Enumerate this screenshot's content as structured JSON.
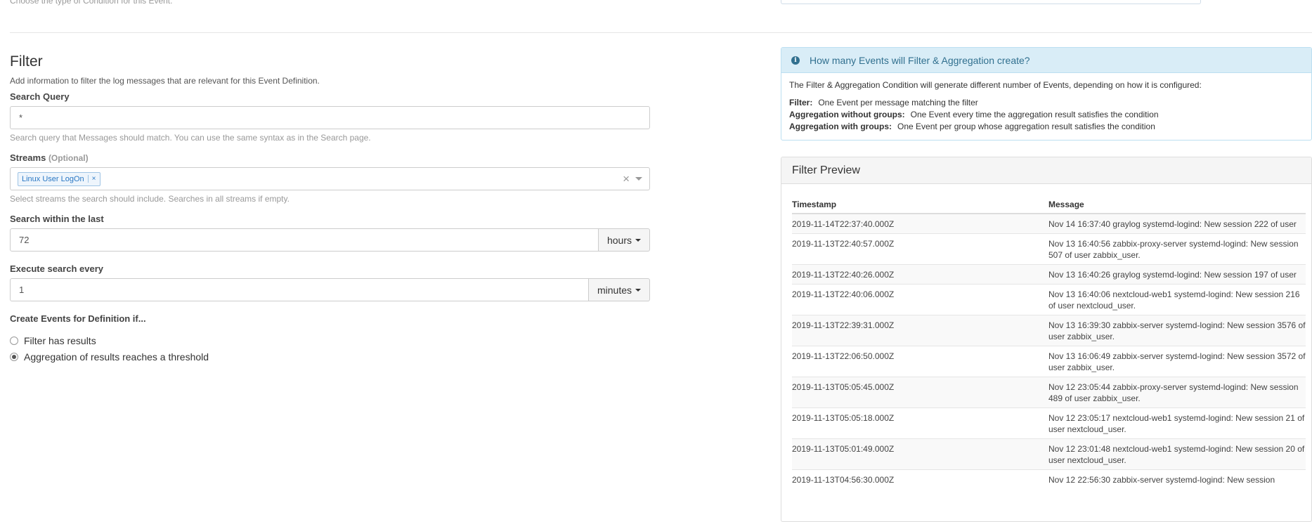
{
  "top": {
    "help_text": "Choose the type of Condition for this Event."
  },
  "filter": {
    "title": "Filter",
    "description": "Add information to filter the log messages that are relevant for this Event Definition.",
    "search_query": {
      "label": "Search Query",
      "value": "*",
      "help": "Search query that Messages should match. You can use the same syntax as in the Search page."
    },
    "streams": {
      "label": "Streams",
      "optional": "(Optional)",
      "selected": [
        "Linux User LogOn"
      ],
      "remove_glyph": "×",
      "help": "Select streams the search should include. Searches in all streams if empty."
    },
    "search_within": {
      "label": "Search within the last",
      "value": "72",
      "unit": "hours"
    },
    "execute_every": {
      "label": "Execute search every",
      "value": "1",
      "unit": "minutes"
    },
    "create_events": {
      "label": "Create Events for Definition if...",
      "options": [
        {
          "label": "Filter has results",
          "checked": false
        },
        {
          "label": "Aggregation of results reaches a threshold",
          "checked": true
        }
      ]
    }
  },
  "info": {
    "icon": "info-circle-icon",
    "title": "How many Events will Filter & Aggregation create?",
    "intro": "The Filter & Aggregation Condition will generate different number of Events, depending on how it is configured:",
    "lines": [
      {
        "term": "Filter:",
        "text": "One Event per message matching the filter"
      },
      {
        "term": "Aggregation without groups:",
        "text": "One Event every time the aggregation result satisfies the condition"
      },
      {
        "term": "Aggregation with groups:",
        "text": "One Event per group whose aggregation result satisfies the condition"
      }
    ]
  },
  "preview": {
    "title": "Filter Preview",
    "columns": [
      "Timestamp",
      "Message"
    ],
    "rows": [
      {
        "timestamp": "2019-11-14T22:37:40.000Z",
        "message": "Nov 14 16:37:40 graylog systemd-logind: New session 222 of user"
      },
      {
        "timestamp": "2019-11-13T22:40:57.000Z",
        "message": "Nov 13 16:40:56 zabbix-proxy-server systemd-logind: New session 507 of user zabbix_user."
      },
      {
        "timestamp": "2019-11-13T22:40:26.000Z",
        "message": "Nov 13 16:40:26 graylog systemd-logind: New session 197 of user"
      },
      {
        "timestamp": "2019-11-13T22:40:06.000Z",
        "message": "Nov 13 16:40:06 nextcloud-web1 systemd-logind: New session 216 of user nextcloud_user."
      },
      {
        "timestamp": "2019-11-13T22:39:31.000Z",
        "message": "Nov 13 16:39:30 zabbix-server systemd-logind: New session 3576 of user zabbix_user."
      },
      {
        "timestamp": "2019-11-13T22:06:50.000Z",
        "message": "Nov 13 16:06:49 zabbix-server systemd-logind: New session 3572 of user zabbix_user."
      },
      {
        "timestamp": "2019-11-13T05:05:45.000Z",
        "message": "Nov 12 23:05:44 zabbix-proxy-server systemd-logind: New session 489 of user zabbix_user."
      },
      {
        "timestamp": "2019-11-13T05:05:18.000Z",
        "message": "Nov 12 23:05:17 nextcloud-web1 systemd-logind: New session 21 of user nextcloud_user."
      },
      {
        "timestamp": "2019-11-13T05:01:49.000Z",
        "message": "Nov 12 23:01:48 nextcloud-web1 systemd-logind: New session 20 of user nextcloud_user."
      },
      {
        "timestamp": "2019-11-13T04:56:30.000Z",
        "message": "Nov 12 22:56:30 zabbix-server systemd-logind: New session"
      }
    ]
  }
}
